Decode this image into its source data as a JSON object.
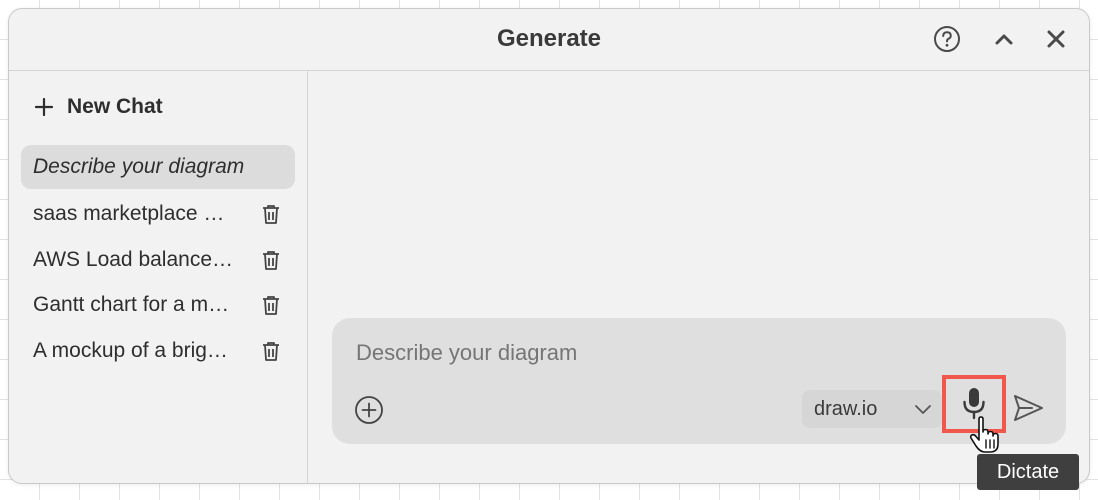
{
  "dialog": {
    "title": "Generate",
    "controls": {
      "help_icon": "question-circle-icon",
      "collapse_icon": "chevron-up-icon",
      "close_icon": "close-icon"
    }
  },
  "sidebar": {
    "new_chat_label": "New Chat",
    "new_chat_icon": "plus-icon",
    "items": [
      {
        "label": "Describe your diagram",
        "active": true
      },
      {
        "label": "saas marketplace design",
        "truncated_display": "saas marketplace …"
      },
      {
        "label": "AWS Load balancer",
        "truncated_display": "AWS Load balance…"
      },
      {
        "label": "Gantt chart for a m…",
        "truncated_display": "Gantt chart for a m…"
      },
      {
        "label": "A mockup of a brig…",
        "truncated_display": "A mockup of a brig…"
      }
    ],
    "delete_icon": "trash-icon"
  },
  "composer": {
    "placeholder": "Describe your diagram",
    "add_icon": "plus-circle-icon",
    "model": {
      "selected": "draw.io",
      "icon": "chevron-down-icon"
    },
    "dictate_icon": "microphone-icon",
    "send_icon": "send-icon"
  },
  "tooltip": {
    "text": "Dictate"
  },
  "colors": {
    "highlight": "#f2574c",
    "dialog_bg": "#f2f2f3",
    "composer_bg": "#dfdfe0",
    "tooltip_bg": "#3f3f3f"
  }
}
